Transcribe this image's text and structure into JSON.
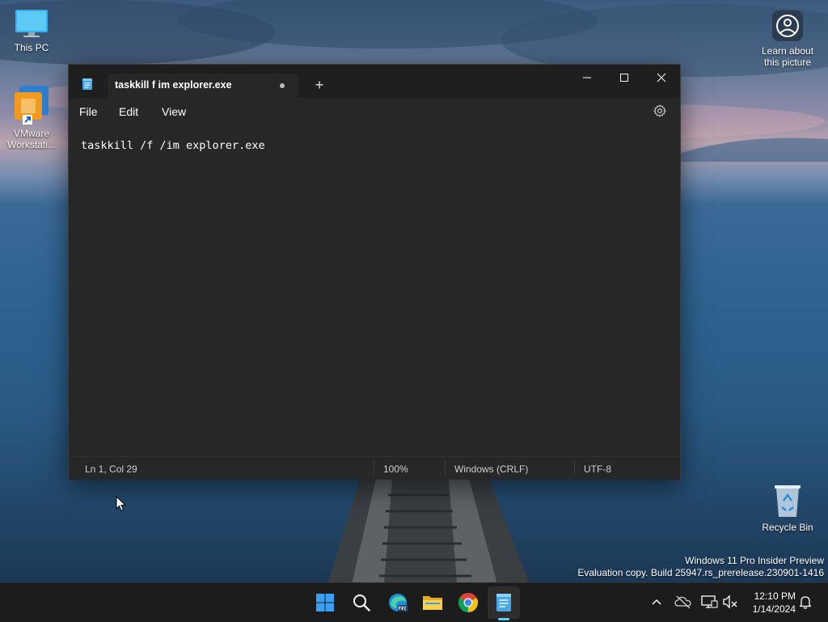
{
  "desktop": {
    "icons": [
      {
        "label": "This PC"
      },
      {
        "label": "VMware Workstati..."
      },
      {
        "label": "Learn about this picture"
      },
      {
        "label": "Recycle Bin"
      }
    ],
    "watermark": {
      "line1": "Windows 11 Pro Insider Preview",
      "line2": "Evaluation copy. Build 25947.rs_prerelease.230901-1416"
    }
  },
  "notepad": {
    "tab_title": "taskkill f im explorer.exe",
    "new_tab_symbol": "+",
    "menu": {
      "file": "File",
      "edit": "Edit",
      "view": "View"
    },
    "content": "taskkill /f /im explorer.exe",
    "status": {
      "position": "Ln 1, Col 29",
      "zoom": "100%",
      "line_ending": "Windows (CRLF)",
      "encoding": "UTF-8"
    },
    "unsaved": true
  },
  "taskbar": {
    "apps": [
      "start-icon",
      "search-icon",
      "edge-pre-icon",
      "file-explorer-icon",
      "chrome-icon",
      "notepad-icon"
    ],
    "active_app": "notepad-icon",
    "tray_icons": [
      "chevron-up-icon",
      "onedrive-icon",
      "network-icon",
      "volume-muted-icon",
      "notification-bell-icon"
    ],
    "time": "12:10 PM",
    "date": "1/14/2024"
  },
  "colors": {
    "accent": "#60cdff",
    "window_bg": "#272727",
    "titlebar_bg": "#1f1f1f",
    "taskbar_bg": "#1c1c1c"
  }
}
